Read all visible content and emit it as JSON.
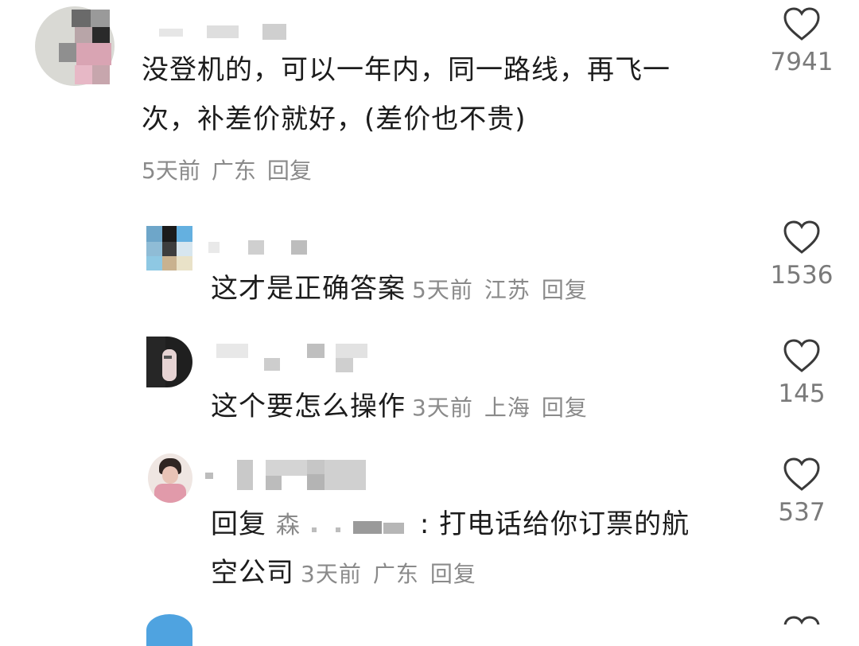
{
  "colors": {
    "text_primary": "#1c1c1c",
    "text_meta": "#8a8a8a",
    "like_count": "#7a7a7a",
    "heart_stroke": "#3a3a3a",
    "background": "#ffffff"
  },
  "comments": [
    {
      "text_line1": "没登机的，可以一年内，同一路线，再飞一",
      "text_line2": "次，补差价就好，(差价也不贵)",
      "time": "5天前",
      "location": "广东",
      "reply_label": "回复",
      "likes": "7941",
      "like_icon": "heart-outline-icon"
    }
  ],
  "replies": [
    {
      "text": "这才是正确答案",
      "time": "5天前",
      "location": "江苏",
      "reply_label": "回复",
      "likes": "1536",
      "like_icon": "heart-outline-icon"
    },
    {
      "text": "这个要怎么操作",
      "time": "3天前",
      "location": "上海",
      "reply_label": "回复",
      "likes": "145",
      "like_icon": "heart-outline-icon"
    },
    {
      "reply_prefix": "回复",
      "mention_visible": "森",
      "text_line1_rest": ": 打电话给你订票的航",
      "text_line2": "空公司",
      "time": "3天前",
      "location": "广东",
      "reply_label": "回复",
      "likes": "537",
      "like_icon": "heart-outline-icon"
    }
  ]
}
